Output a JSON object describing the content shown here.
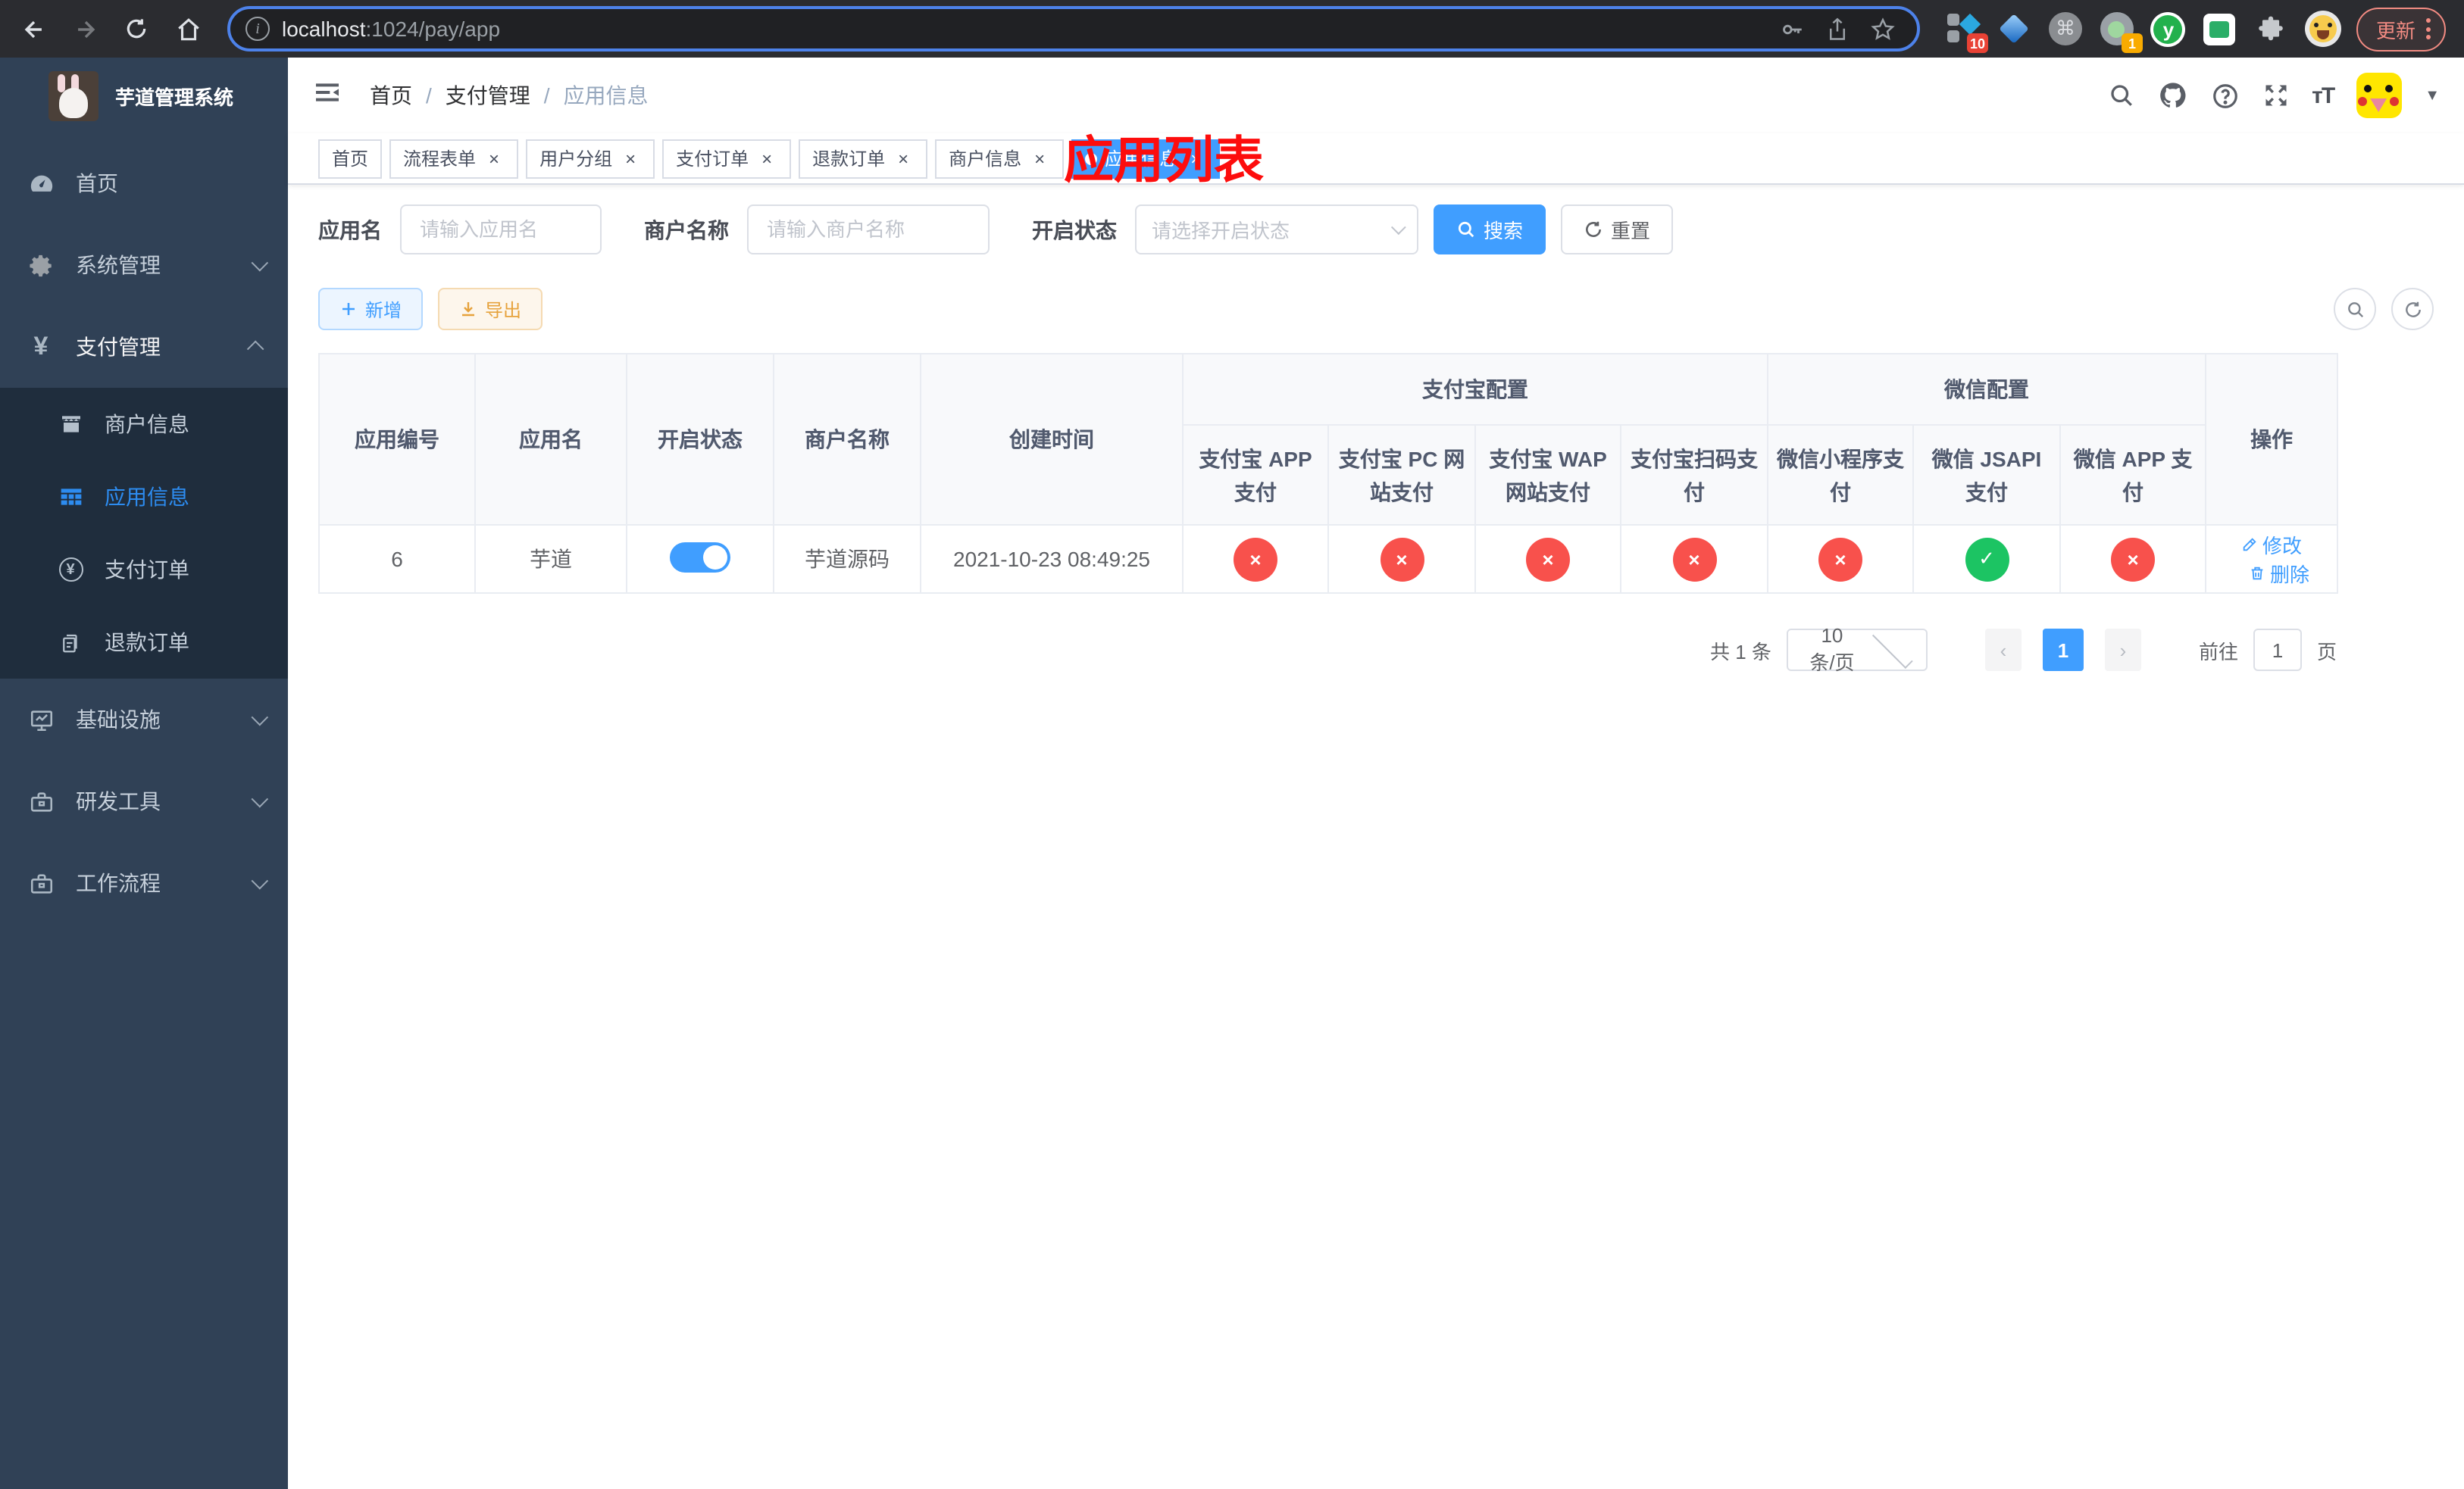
{
  "browser": {
    "url": {
      "host": "localhost",
      "path": ":1024/pay/app"
    },
    "update_button": "更新",
    "ext_badges": {
      "red": "10",
      "orange": "1"
    },
    "ext_y_letter": "y",
    "command_glyph": "⌘"
  },
  "sidebar": {
    "title": "芋道管理系统",
    "menu": [
      {
        "label": "首页"
      },
      {
        "label": "系统管理"
      },
      {
        "label": "支付管理"
      },
      {
        "label": "基础设施"
      },
      {
        "label": "研发工具"
      },
      {
        "label": "工作流程"
      }
    ],
    "submenu": [
      {
        "label": "商户信息"
      },
      {
        "label": "应用信息"
      },
      {
        "label": "支付订单"
      },
      {
        "label": "退款订单"
      }
    ]
  },
  "navbar": {
    "breadcrumb": {
      "home": "首页",
      "section": "支付管理",
      "current": "应用信息",
      "separator": "/"
    },
    "overlay_title": "应用列表"
  },
  "tabs": [
    {
      "label": "首页"
    },
    {
      "label": "流程表单"
    },
    {
      "label": "用户分组"
    },
    {
      "label": "支付订单"
    },
    {
      "label": "退款订单"
    },
    {
      "label": "商户信息"
    },
    {
      "label": "应用信息"
    }
  ],
  "filters": {
    "app_name_label": "应用名",
    "app_name_placeholder": "请输入应用名",
    "merchant_label": "商户名称",
    "merchant_placeholder": "请输入商户名称",
    "status_label": "开启状态",
    "status_placeholder": "请选择开启状态",
    "search_button": "搜索",
    "reset_button": "重置"
  },
  "toolbar": {
    "add_button": "新增",
    "export_button": "导出"
  },
  "table": {
    "columns": {
      "app_id": "应用编号",
      "app_name": "应用名",
      "status": "开启状态",
      "merchant": "商户名称",
      "create_time": "创建时间",
      "alipay_group": "支付宝配置",
      "wechat_group": "微信配置",
      "actions": "操作",
      "alipay_app": "支付宝 APP 支付",
      "alipay_pc": "支付宝 PC 网站支付",
      "alipay_wap": "支付宝 WAP 网站支付",
      "alipay_qr": "支付宝扫码支付",
      "wx_lite": "微信小程序支付",
      "wx_jsapi": "微信 JSAPI 支付",
      "wx_app": "微信 APP 支付"
    },
    "row": {
      "app_id": "6",
      "app_name": "芋道",
      "status_on": true,
      "merchant": "芋道源码",
      "create_time": "2021-10-23 08:49:25",
      "channels": [
        "fail",
        "fail",
        "fail",
        "fail",
        "fail",
        "ok",
        "fail"
      ],
      "edit_label": "修改",
      "delete_label": "删除"
    }
  },
  "pagination": {
    "total": "共 1 条",
    "page_size": "10条/页",
    "current_page": "1",
    "goto_label": "前往",
    "goto_value": "1",
    "page_suffix": "页"
  },
  "icons": {
    "sidebar": [
      "dashboard-gauge",
      "gear",
      "yen",
      "store",
      "grid-table",
      "yen-circle",
      "document",
      "monitor-chart",
      "toolbox",
      "briefcase"
    ],
    "navbar": [
      "hamburger-fold",
      "search",
      "github",
      "help-circle",
      "fullscreen",
      "font-size",
      "avatar",
      "caret-down"
    ],
    "browser": [
      "back-arrow",
      "forward-arrow",
      "reload",
      "home",
      "info-circle",
      "key",
      "share",
      "star",
      "extensions-puzzle",
      "profile-emoji"
    ]
  },
  "colors": {
    "primary": "#409eff",
    "success": "#1cc463",
    "danger": "#f8514c",
    "warning": "#e6a23c",
    "sidebar_bg": "#304156",
    "submenu_bg": "#1f2d3d",
    "annotation_red": "#fd0d0d"
  }
}
